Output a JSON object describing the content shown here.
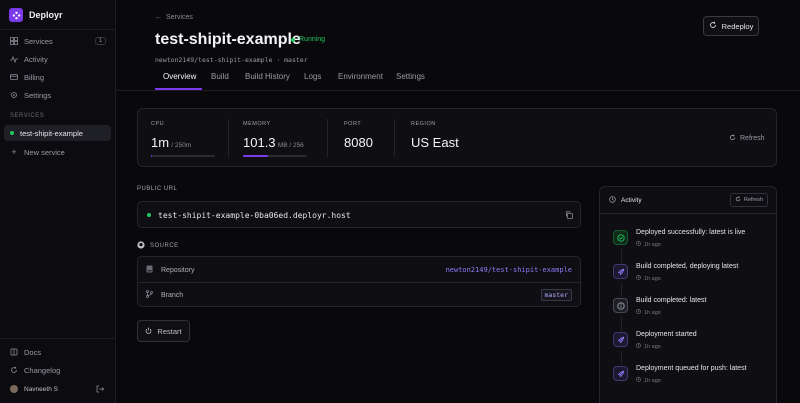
{
  "app": {
    "name": "Deployr"
  },
  "sidebar": {
    "nav": [
      {
        "label": "Services",
        "icon": "grid-icon",
        "count": "1"
      },
      {
        "label": "Activity",
        "icon": "pulse-icon"
      },
      {
        "label": "Billing",
        "icon": "card-icon"
      },
      {
        "label": "Settings",
        "icon": "gear-icon"
      }
    ],
    "section_title": "SERVICES",
    "service": "test-shipit-example",
    "new_service": "New service",
    "docs": "Docs",
    "changelog": "Changelog",
    "user": "Navneeth S"
  },
  "header": {
    "back": "Services",
    "title": "test-shipit-example",
    "status": "Running",
    "subline": "newton2149/test-shipit-example · master",
    "redeploy": "Redeploy",
    "tabs": [
      "Overview",
      "Build",
      "Build History",
      "Logs",
      "Environment",
      "Settings"
    ],
    "active_tab": "Overview"
  },
  "metrics": {
    "cpu": {
      "label": "CPU",
      "value": "1m",
      "unit": "/ 250m",
      "fraction": 0.004
    },
    "memory": {
      "label": "MEMORY",
      "value": "101.3",
      "unit": "MB / 256",
      "fraction": 0.396
    },
    "port": {
      "label": "PORT",
      "value": "8080"
    },
    "region": {
      "label": "REGION",
      "value": "US East"
    },
    "refresh": "Refresh"
  },
  "public_url": {
    "label": "PUBLIC URL",
    "url": "test-shipit-example-0ba06ed.deployr.host"
  },
  "source": {
    "label": "SOURCE",
    "repository_label": "Repository",
    "repository": "newton2149/test-shipit-example",
    "branch_label": "Branch",
    "branch": "master"
  },
  "restart": "Restart",
  "activity": {
    "title": "Activity",
    "refresh": "Refresh",
    "items": [
      {
        "title": "Deployed successfully: latest is live",
        "time": "1h ago",
        "icon": "check-icon",
        "color": "#22c55e"
      },
      {
        "title": "Build completed, deploying latest",
        "time": "1h ago",
        "icon": "rocket-icon",
        "color": "#8b7cf6"
      },
      {
        "title": "Build completed: latest",
        "time": "1h ago",
        "icon": "info-icon",
        "color": "#a0a0a8"
      },
      {
        "title": "Deployment started",
        "time": "1h ago",
        "icon": "rocket-icon",
        "color": "#8b7cf6"
      },
      {
        "title": "Deployment queued for push: latest",
        "time": "1h ago",
        "icon": "rocket-icon",
        "color": "#8b7cf6"
      }
    ]
  }
}
